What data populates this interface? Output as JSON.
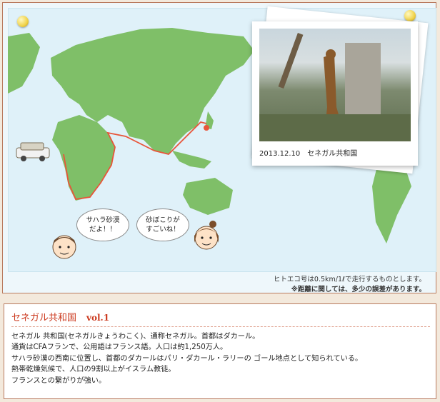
{
  "photo": {
    "caption": "2013.12.10　セネガル共和国"
  },
  "bubbles": {
    "boy": "サハラ砂漠\nだよ！！",
    "girl": "砂ぼこりが\nすごいね！"
  },
  "notes": {
    "line1": "ヒトエコ号は0.5km/1ℓで走行するものとします。",
    "line2": "※距離に関しては、多少の誤差があります。"
  },
  "info": {
    "title": "セネガル共和国",
    "vol": "vol.1",
    "lines": [
      "セネガル 共和国(セネガルきょうわこく)、通称セネガル。首都はダカール。",
      "通貨はCFAフランで、公用語はフランス語。人口は約1,250万人。",
      "サハラ砂漠の西南に位置し、首都のダカールはパリ・ダカール・ラリーの ゴール地点として知られている。",
      "熱帯乾燥気候で、人口の9割以上がイスラム教徒。",
      "フランスとの繋がりが強い。"
    ]
  },
  "colors": {
    "land": "#7fbf68",
    "ocean": "#dff1f9",
    "route": "#e8553a",
    "accent": "#cc3a1f"
  }
}
